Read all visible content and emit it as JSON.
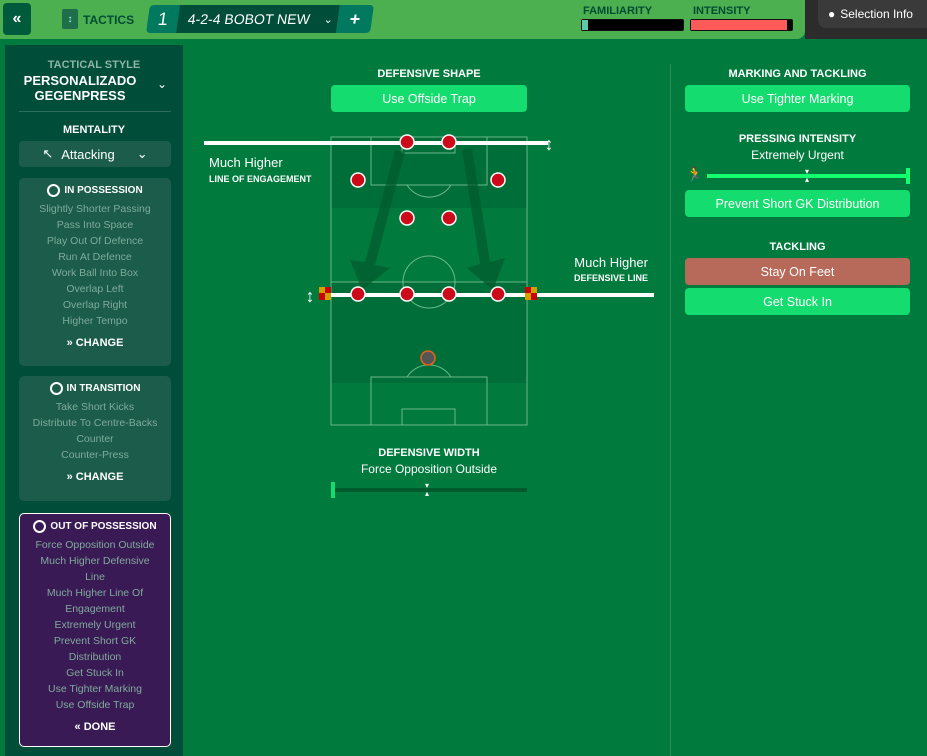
{
  "topbar": {
    "back_icon": "double-chevron-left",
    "tactics_label": "TACTICS",
    "slot": "1",
    "tactic_name": "4-2-4 BOBOT NEW",
    "add": "+",
    "familiarity_label": "FAMILIARITY",
    "familiarity_level": 0.06,
    "intensity_label": "INTENSITY",
    "intensity_level": 0.95,
    "selection_info": "Selection Info",
    "colors": {
      "topbar": "#4caf50",
      "intensity": "#ff5a5a",
      "familiarity": "#5fc9a8"
    }
  },
  "sidebar": {
    "tactical_style_label": "TACTICAL STYLE",
    "tactical_style_line1": "PERSONALIZADO",
    "tactical_style_line2": "GEGENPRESS",
    "mentality_label": "MENTALITY",
    "mentality": "Attacking",
    "in_possession": {
      "title": "IN POSSESSION",
      "items": [
        "Slightly Shorter Passing",
        "Pass Into Space",
        "Play Out Of Defence",
        "Run At Defence",
        "Work Ball Into Box",
        "Overlap Left",
        "Overlap Right",
        "Higher Tempo"
      ],
      "action": "CHANGE"
    },
    "in_transition": {
      "title": "IN TRANSITION",
      "items": [
        "Take Short Kicks",
        "Distribute To Centre-Backs",
        "Counter",
        "Counter-Press"
      ],
      "action": "CHANGE"
    },
    "out_of_possession": {
      "title": "OUT OF POSSESSION",
      "items": [
        "Force Opposition Outside",
        "Much Higher Defensive",
        "Line",
        "Much Higher Line Of",
        "Engagement",
        "Extremely Urgent",
        "Prevent Short GK",
        "Distribution",
        "Get Stuck In",
        "Use Tighter Marking",
        "Use Offside Trap"
      ],
      "action": "DONE"
    }
  },
  "shape": {
    "title": "DEFENSIVE SHAPE",
    "offside_button": "Use Offside Trap",
    "engagement_value": "Much Higher",
    "engagement_label": "LINE OF ENGAGEMENT",
    "defline_value": "Much Higher",
    "defline_label": "DEFENSIVE LINE",
    "width_title": "DEFENSIVE WIDTH",
    "width_value": "Force Opposition Outside",
    "width_level": 0.5
  },
  "marking": {
    "title": "MARKING AND TACKLING",
    "tighter_button": "Use Tighter Marking",
    "pressing_title": "PRESSING INTENSITY",
    "pressing_value": "Extremely Urgent",
    "pressing_level": 1.0,
    "gk_button": "Prevent Short GK Distribution",
    "tackling_title": "TACKLING",
    "stay_button": "Stay On Feet",
    "stuck_button": "Get Stuck In",
    "colors": {
      "active": "#14dc6e",
      "inactive": "#b86a5a"
    }
  }
}
